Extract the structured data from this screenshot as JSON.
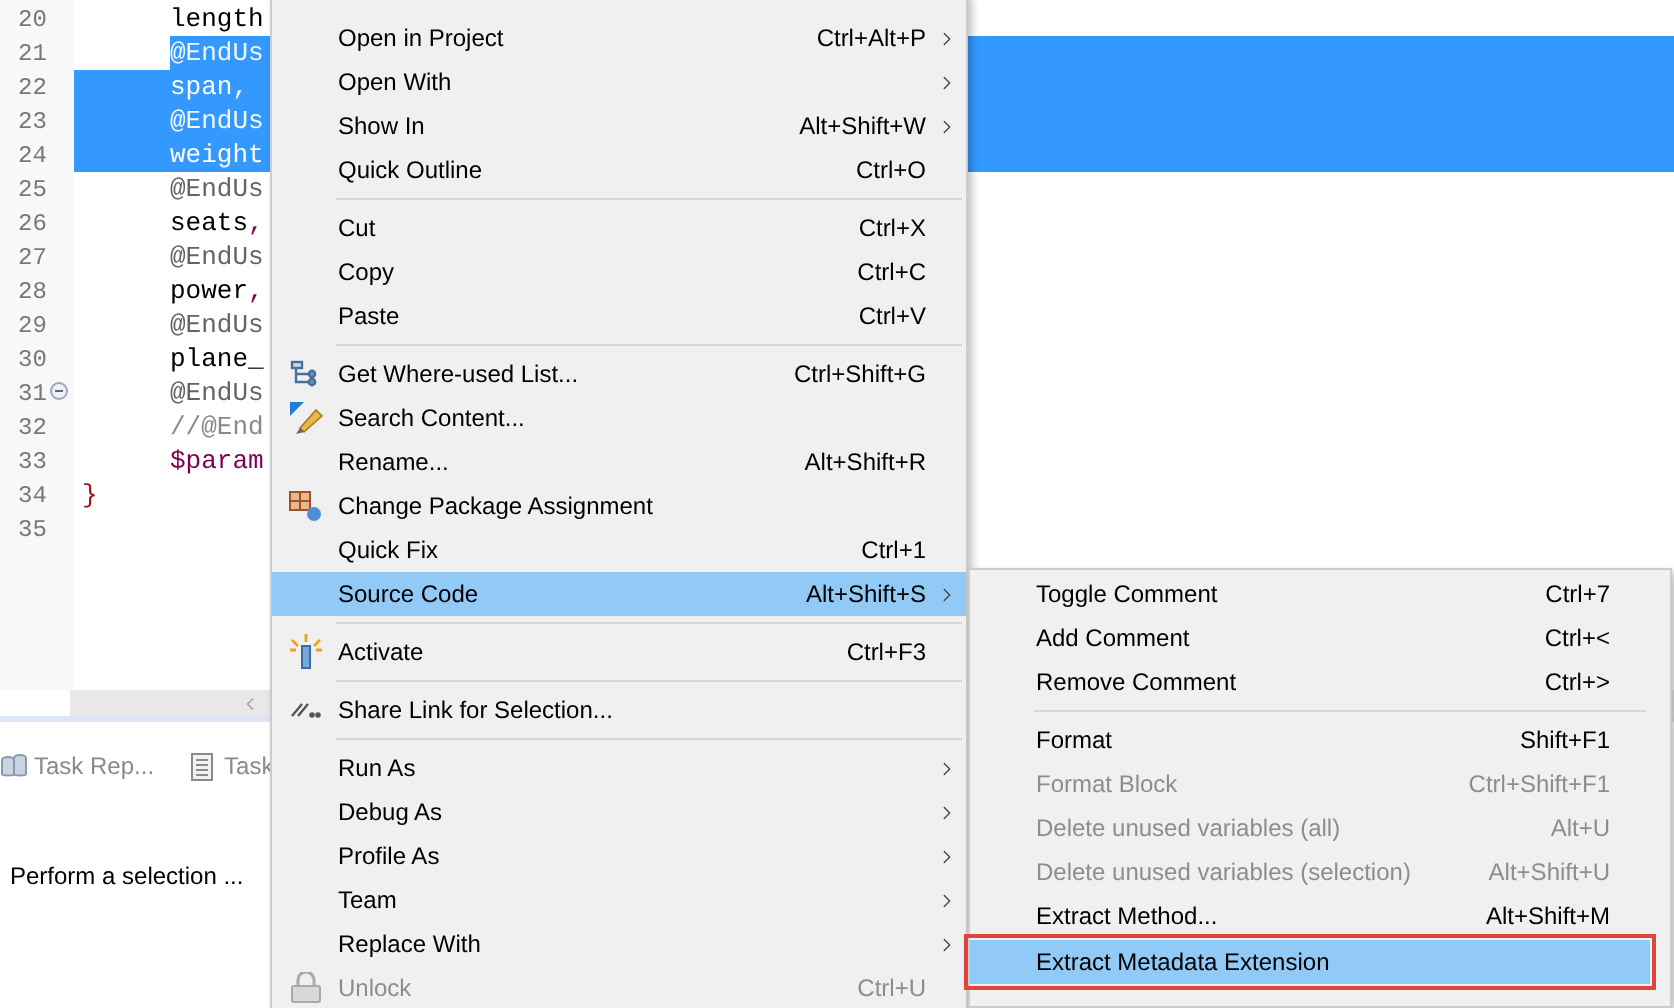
{
  "editor": {
    "lines": [
      {
        "number": "20",
        "selected": false,
        "fold": false,
        "indented": true,
        "tokens": [
          {
            "text": "length",
            "kind": "plain"
          }
        ]
      },
      {
        "number": "21",
        "selected": true,
        "partial": true,
        "fold": false,
        "indented": true,
        "tokens": [
          {
            "text": "@EndUs",
            "kind": "annotation"
          }
        ]
      },
      {
        "number": "22",
        "selected": true,
        "fold": false,
        "indented": true,
        "tokens": [
          {
            "text": "span",
            "kind": "plain"
          },
          {
            "text": ",",
            "kind": "punct"
          }
        ]
      },
      {
        "number": "23",
        "selected": true,
        "fold": false,
        "indented": true,
        "tokens": [
          {
            "text": "@EndUs",
            "kind": "annotation"
          }
        ]
      },
      {
        "number": "24",
        "selected": true,
        "fold": false,
        "indented": true,
        "tokens": [
          {
            "text": "weight",
            "kind": "plain"
          }
        ]
      },
      {
        "number": "25",
        "selected": false,
        "fold": false,
        "indented": true,
        "tokens": [
          {
            "text": "@EndUs",
            "kind": "annotation"
          }
        ]
      },
      {
        "number": "26",
        "selected": false,
        "fold": false,
        "indented": true,
        "tokens": [
          {
            "text": "seats",
            "kind": "plain"
          },
          {
            "text": ",",
            "kind": "punct"
          }
        ]
      },
      {
        "number": "27",
        "selected": false,
        "fold": false,
        "indented": true,
        "tokens": [
          {
            "text": "@EndUs",
            "kind": "annotation"
          }
        ]
      },
      {
        "number": "28",
        "selected": false,
        "fold": false,
        "indented": true,
        "tokens": [
          {
            "text": "power",
            "kind": "plain"
          },
          {
            "text": ",",
            "kind": "punct"
          }
        ]
      },
      {
        "number": "29",
        "selected": false,
        "fold": false,
        "indented": true,
        "tokens": [
          {
            "text": "@EndUs",
            "kind": "annotation"
          }
        ]
      },
      {
        "number": "30",
        "selected": false,
        "fold": false,
        "indented": true,
        "tokens": [
          {
            "text": "plane_",
            "kind": "plain"
          }
        ]
      },
      {
        "number": "31",
        "selected": false,
        "fold": true,
        "indented": true,
        "tokens": [
          {
            "text": "@EndUs",
            "kind": "annotation"
          }
        ]
      },
      {
        "number": "32",
        "selected": false,
        "fold": false,
        "indented": true,
        "tokens": [
          {
            "text": "//@End",
            "kind": "comment"
          }
        ]
      },
      {
        "number": "33",
        "selected": false,
        "fold": false,
        "indented": true,
        "tokens": [
          {
            "text": "$param",
            "kind": "variable"
          }
        ]
      },
      {
        "number": "34",
        "selected": false,
        "fold": false,
        "indented": false,
        "tokens": [
          {
            "text": "}",
            "kind": "brace"
          }
        ]
      },
      {
        "number": "35",
        "selected": false,
        "fold": false
      }
    ]
  },
  "bottom_panel": {
    "tabs": [
      {
        "label": "Task Rep..."
      },
      {
        "label": "Task"
      }
    ],
    "message": "Perform a selection ..."
  },
  "context_menu": {
    "items": [
      {
        "kind": "item",
        "label": "Open in Project",
        "shortcut": "Ctrl+Alt+P",
        "submenu": true,
        "disabled": false,
        "selected": false
      },
      {
        "kind": "item",
        "label": "Open With",
        "submenu": true,
        "disabled": false,
        "selected": false
      },
      {
        "kind": "item",
        "label": "Show In",
        "shortcut": "Alt+Shift+W",
        "submenu": true,
        "disabled": false,
        "selected": false
      },
      {
        "kind": "item",
        "label": "Quick Outline",
        "shortcut": "Ctrl+O",
        "submenu": false,
        "disabled": false,
        "selected": false
      },
      {
        "kind": "separator"
      },
      {
        "kind": "item",
        "label": "Cut",
        "shortcut": "Ctrl+X",
        "submenu": false,
        "disabled": false,
        "selected": false
      },
      {
        "kind": "item",
        "label": "Copy",
        "shortcut": "Ctrl+C",
        "submenu": false,
        "disabled": false,
        "selected": false
      },
      {
        "kind": "item",
        "label": "Paste",
        "shortcut": "Ctrl+V",
        "submenu": false,
        "disabled": false,
        "selected": false
      },
      {
        "kind": "separator"
      },
      {
        "kind": "item",
        "label": "Get Where-used List...",
        "shortcut": "Ctrl+Shift+G",
        "submenu": false,
        "disabled": false,
        "selected": false
      },
      {
        "kind": "item",
        "label": "Search Content...",
        "submenu": false,
        "disabled": false,
        "selected": false
      },
      {
        "kind": "item",
        "label": "Rename...",
        "shortcut": "Alt+Shift+R",
        "submenu": false,
        "disabled": false,
        "selected": false
      },
      {
        "kind": "item",
        "label": "Change Package Assignment",
        "submenu": false,
        "disabled": false,
        "selected": false
      },
      {
        "kind": "item",
        "label": "Quick Fix",
        "shortcut": "Ctrl+1",
        "submenu": false,
        "disabled": false,
        "selected": false
      },
      {
        "kind": "item",
        "label": "Source Code",
        "shortcut": "Alt+Shift+S",
        "submenu": true,
        "disabled": false,
        "selected": true
      },
      {
        "kind": "separator"
      },
      {
        "kind": "item",
        "label": "Activate",
        "shortcut": "Ctrl+F3",
        "submenu": false,
        "disabled": false,
        "selected": false
      },
      {
        "kind": "separator"
      },
      {
        "kind": "item",
        "label": "Share Link for Selection...",
        "submenu": false,
        "disabled": false,
        "selected": false
      },
      {
        "kind": "separator"
      },
      {
        "kind": "item",
        "label": "Run As",
        "submenu": true,
        "disabled": false,
        "selected": false
      },
      {
        "kind": "item",
        "label": "Debug As",
        "submenu": true,
        "disabled": false,
        "selected": false
      },
      {
        "kind": "item",
        "label": "Profile As",
        "submenu": true,
        "disabled": false,
        "selected": false
      },
      {
        "kind": "item",
        "label": "Team",
        "submenu": true,
        "disabled": false,
        "selected": false
      },
      {
        "kind": "item",
        "label": "Replace With",
        "submenu": true,
        "disabled": false,
        "selected": false
      },
      {
        "kind": "item",
        "label": "Unlock",
        "shortcut": "Ctrl+U",
        "submenu": false,
        "disabled": true,
        "selected": false
      }
    ]
  },
  "submenu": {
    "items": [
      {
        "kind": "item",
        "label": "Toggle Comment",
        "shortcut": "Ctrl+7",
        "disabled": false,
        "selected": false
      },
      {
        "kind": "item",
        "label": "Add Comment",
        "shortcut": "Ctrl+<",
        "disabled": false,
        "selected": false
      },
      {
        "kind": "item",
        "label": "Remove Comment",
        "shortcut": "Ctrl+>",
        "disabled": false,
        "selected": false
      },
      {
        "kind": "separator"
      },
      {
        "kind": "item",
        "label": "Format",
        "shortcut": "Shift+F1",
        "disabled": false,
        "selected": false
      },
      {
        "kind": "item",
        "label": "Format Block",
        "shortcut": "Ctrl+Shift+F1",
        "disabled": true,
        "selected": false
      },
      {
        "kind": "item",
        "label": "Delete unused variables (all)",
        "shortcut": "Alt+U",
        "disabled": true,
        "selected": false
      },
      {
        "kind": "item",
        "label": "Delete unused variables (selection)",
        "shortcut": "Alt+Shift+U",
        "disabled": true,
        "selected": false
      },
      {
        "kind": "item",
        "label": "Extract Method...",
        "shortcut": "Alt+Shift+M",
        "disabled": false,
        "selected": false
      },
      {
        "kind": "item",
        "label": "Extract Metadata Extension",
        "disabled": false,
        "selected": true,
        "outlined": true
      }
    ]
  }
}
